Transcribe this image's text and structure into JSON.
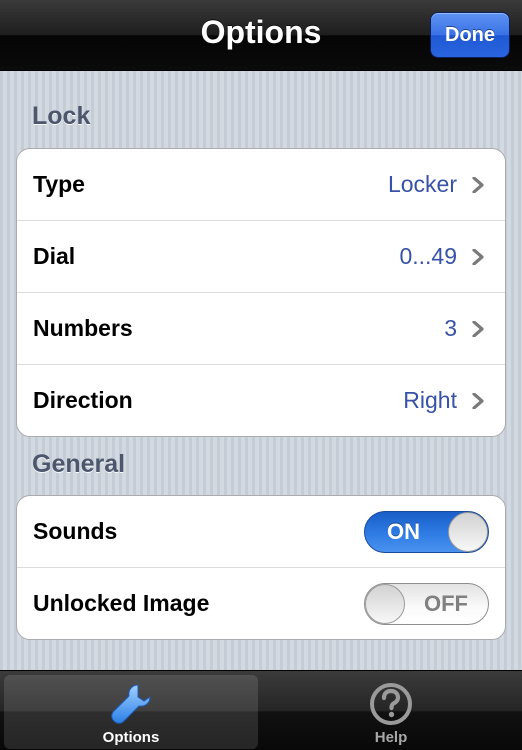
{
  "navbar": {
    "title": "Options",
    "done_label": "Done"
  },
  "lock_section": {
    "header": "Lock",
    "rows": [
      {
        "label": "Type",
        "value": "Locker"
      },
      {
        "label": "Dial",
        "value": "0...49"
      },
      {
        "label": "Numbers",
        "value": "3"
      },
      {
        "label": "Direction",
        "value": "Right"
      }
    ]
  },
  "general_section": {
    "header": "General",
    "rows": [
      {
        "label": "Sounds",
        "toggle_text": "ON",
        "state": "on"
      },
      {
        "label": "Unlocked Image",
        "toggle_text": "OFF",
        "state": "off"
      }
    ]
  },
  "tabbar": {
    "tabs": [
      {
        "label": "Options",
        "icon": "wrench-icon",
        "selected": true
      },
      {
        "label": "Help",
        "icon": "question-circle-icon",
        "selected": false
      }
    ]
  },
  "colors": {
    "value_text": "#3852a8",
    "done_button": "#2a64de",
    "toggle_on": "#2e7ce4",
    "section_header": "#4c566c"
  }
}
